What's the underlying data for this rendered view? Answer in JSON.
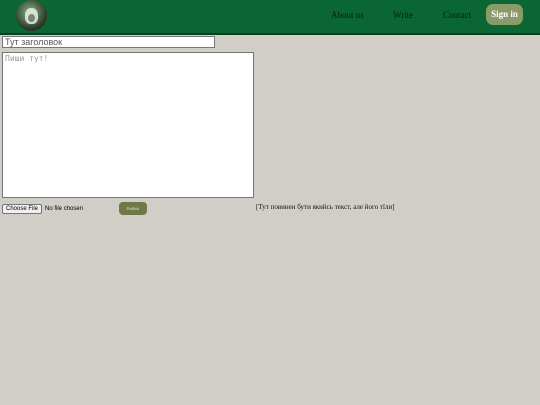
{
  "header": {
    "logo_icon": "cat-logo-icon",
    "nav": {
      "about": "About us",
      "write": "Write",
      "contact": "Contact"
    },
    "signin_label": "Sign in",
    "colors": {
      "header_bg": "#0a6633",
      "signin_bg": "#8a9a68"
    }
  },
  "editor": {
    "title_placeholder": "Тут заголовок",
    "title_value": "",
    "body_placeholder": "Пиши тут!",
    "body_value": "",
    "file_button_label": "Choose File",
    "file_status": "No file chosen",
    "publish_label": "Publish",
    "publish_color": "#6e7a45"
  },
  "preview": {
    "text": "[Тут повинен бути якийсь текст, але його тїли]"
  },
  "page": {
    "background": "#d1cec7"
  }
}
